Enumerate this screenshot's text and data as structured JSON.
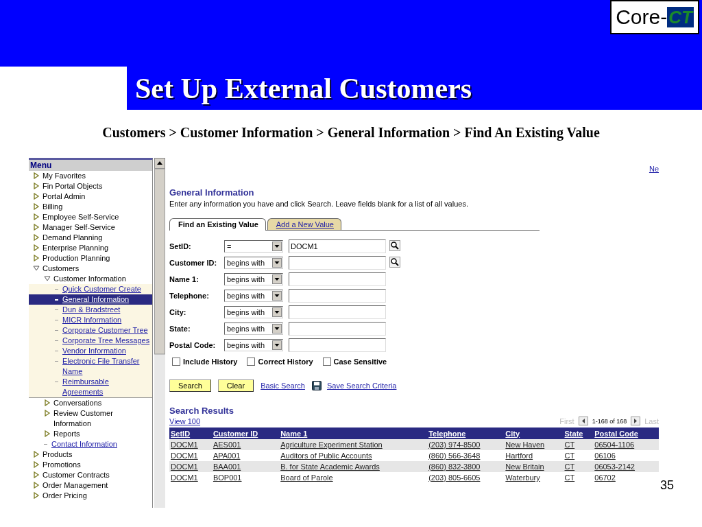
{
  "slide": {
    "logo": {
      "text": "Core-",
      "mark": "CT"
    },
    "title": "Set Up External Customers",
    "breadcrumb": "Customers > Customer Information > General Information > Find An Existing Value",
    "slide_number": "35"
  },
  "menu": {
    "title": "Menu",
    "items": [
      {
        "label": "My Favorites",
        "kind": "folder",
        "expanded": false
      },
      {
        "label": "Fin Portal Objects",
        "kind": "folder",
        "expanded": false
      },
      {
        "label": "Portal Admin",
        "kind": "folder",
        "expanded": false
      },
      {
        "label": "Billing",
        "kind": "folder",
        "expanded": false
      },
      {
        "label": "Employee Self-Service",
        "kind": "folder",
        "expanded": false
      },
      {
        "label": "Manager Self-Service",
        "kind": "folder",
        "expanded": false
      },
      {
        "label": "Demand Planning",
        "kind": "folder",
        "expanded": false
      },
      {
        "label": "Enterprise Planning",
        "kind": "folder",
        "expanded": false
      },
      {
        "label": "Production Planning",
        "kind": "folder",
        "expanded": false
      },
      {
        "label": "Customers",
        "kind": "folder",
        "expanded": true,
        "children": [
          {
            "label": "Customer Information",
            "kind": "folder",
            "expanded": true,
            "children": [
              {
                "label": "Quick Customer Create",
                "kind": "link",
                "selected": false
              },
              {
                "label": "General Information",
                "kind": "link",
                "selected": true
              },
              {
                "label": "Dun & Bradstreet",
                "kind": "link",
                "selected": false
              },
              {
                "label": "MICR Information",
                "kind": "link",
                "selected": false
              },
              {
                "label": "Corporate Customer Tree",
                "kind": "link",
                "selected": false
              },
              {
                "label": "Corporate Tree Messages",
                "kind": "link",
                "selected": false
              },
              {
                "label": "Vendor Information",
                "kind": "link",
                "selected": false
              },
              {
                "label": "Electronic File Transfer Name",
                "kind": "link",
                "selected": false
              },
              {
                "label": "Reimbursable Agreements",
                "kind": "link",
                "selected": false
              }
            ]
          },
          {
            "label": "Conversations",
            "kind": "folder",
            "expanded": false
          },
          {
            "label": "Review Customer Information",
            "kind": "folder",
            "expanded": false
          },
          {
            "label": "Reports",
            "kind": "folder",
            "expanded": false
          },
          {
            "label": "Contact Information",
            "kind": "link",
            "selected": false
          }
        ]
      },
      {
        "label": "Products",
        "kind": "folder",
        "expanded": false
      },
      {
        "label": "Promotions",
        "kind": "folder",
        "expanded": false
      },
      {
        "label": "Customer Contracts",
        "kind": "folder",
        "expanded": false
      },
      {
        "label": "Order Management",
        "kind": "folder",
        "expanded": false
      },
      {
        "label": "Order Pricing",
        "kind": "folder",
        "expanded": false
      }
    ]
  },
  "page": {
    "top_link": "Ne",
    "heading": "General Information",
    "instructions": "Enter any information you have and click Search. Leave fields blank for a list of all values.",
    "tabs": [
      {
        "label": "Find an Existing Value",
        "selected": true
      },
      {
        "label": "Add a New Value",
        "selected": false
      }
    ],
    "fields": [
      {
        "label": "SetID:",
        "operator": "=",
        "value": "DOCM1",
        "lookup": true
      },
      {
        "label": "Customer ID:",
        "operator": "begins with",
        "lookup": true
      },
      {
        "label": "Name 1:",
        "operator": "begins with",
        "lookup": false
      },
      {
        "label": "Telephone:",
        "operator": "begins with",
        "lookup": false
      },
      {
        "label": "City:",
        "operator": "begins with",
        "lookup": false
      },
      {
        "label": "State:",
        "operator": "begins with",
        "lookup": false
      },
      {
        "label": "Postal Code:",
        "operator": "begins with",
        "lookup": false
      }
    ],
    "checkboxes": [
      {
        "label": "Include History",
        "checked": false
      },
      {
        "label": "Correct History",
        "checked": false
      },
      {
        "label": "Case Sensitive",
        "checked": false
      }
    ],
    "buttons": [
      "Search",
      "Clear"
    ],
    "links": [
      "Basic Search",
      "Save Search Criteria"
    ],
    "results": {
      "title": "Search Results",
      "view_link": "View 100",
      "pager": {
        "first": "First",
        "range": "1-168 of 168",
        "last": "Last"
      },
      "columns": [
        "SetID",
        "Customer ID",
        "Name 1",
        "Telephone",
        "City",
        "State",
        "Postal Code"
      ],
      "rows": [
        [
          "DOCM1",
          "AES001",
          "Agriculture Experiment Station",
          "(203) 974-8500",
          "New Haven",
          "CT",
          "06504-1106"
        ],
        [
          "DOCM1",
          "APA001",
          "Auditors of Public Accounts",
          "(860) 566-3648",
          "Hartford",
          "CT",
          "06106"
        ],
        [
          "DOCM1",
          "BAA001",
          "B. for State Academic Awards",
          "(860) 832-3800",
          "New Britain",
          "CT",
          "06053-2142"
        ],
        [
          "DOCM1",
          "BOP001",
          "Board of Parole",
          "(203) 805-6605",
          "Waterbury",
          "CT",
          "06702"
        ]
      ]
    }
  }
}
